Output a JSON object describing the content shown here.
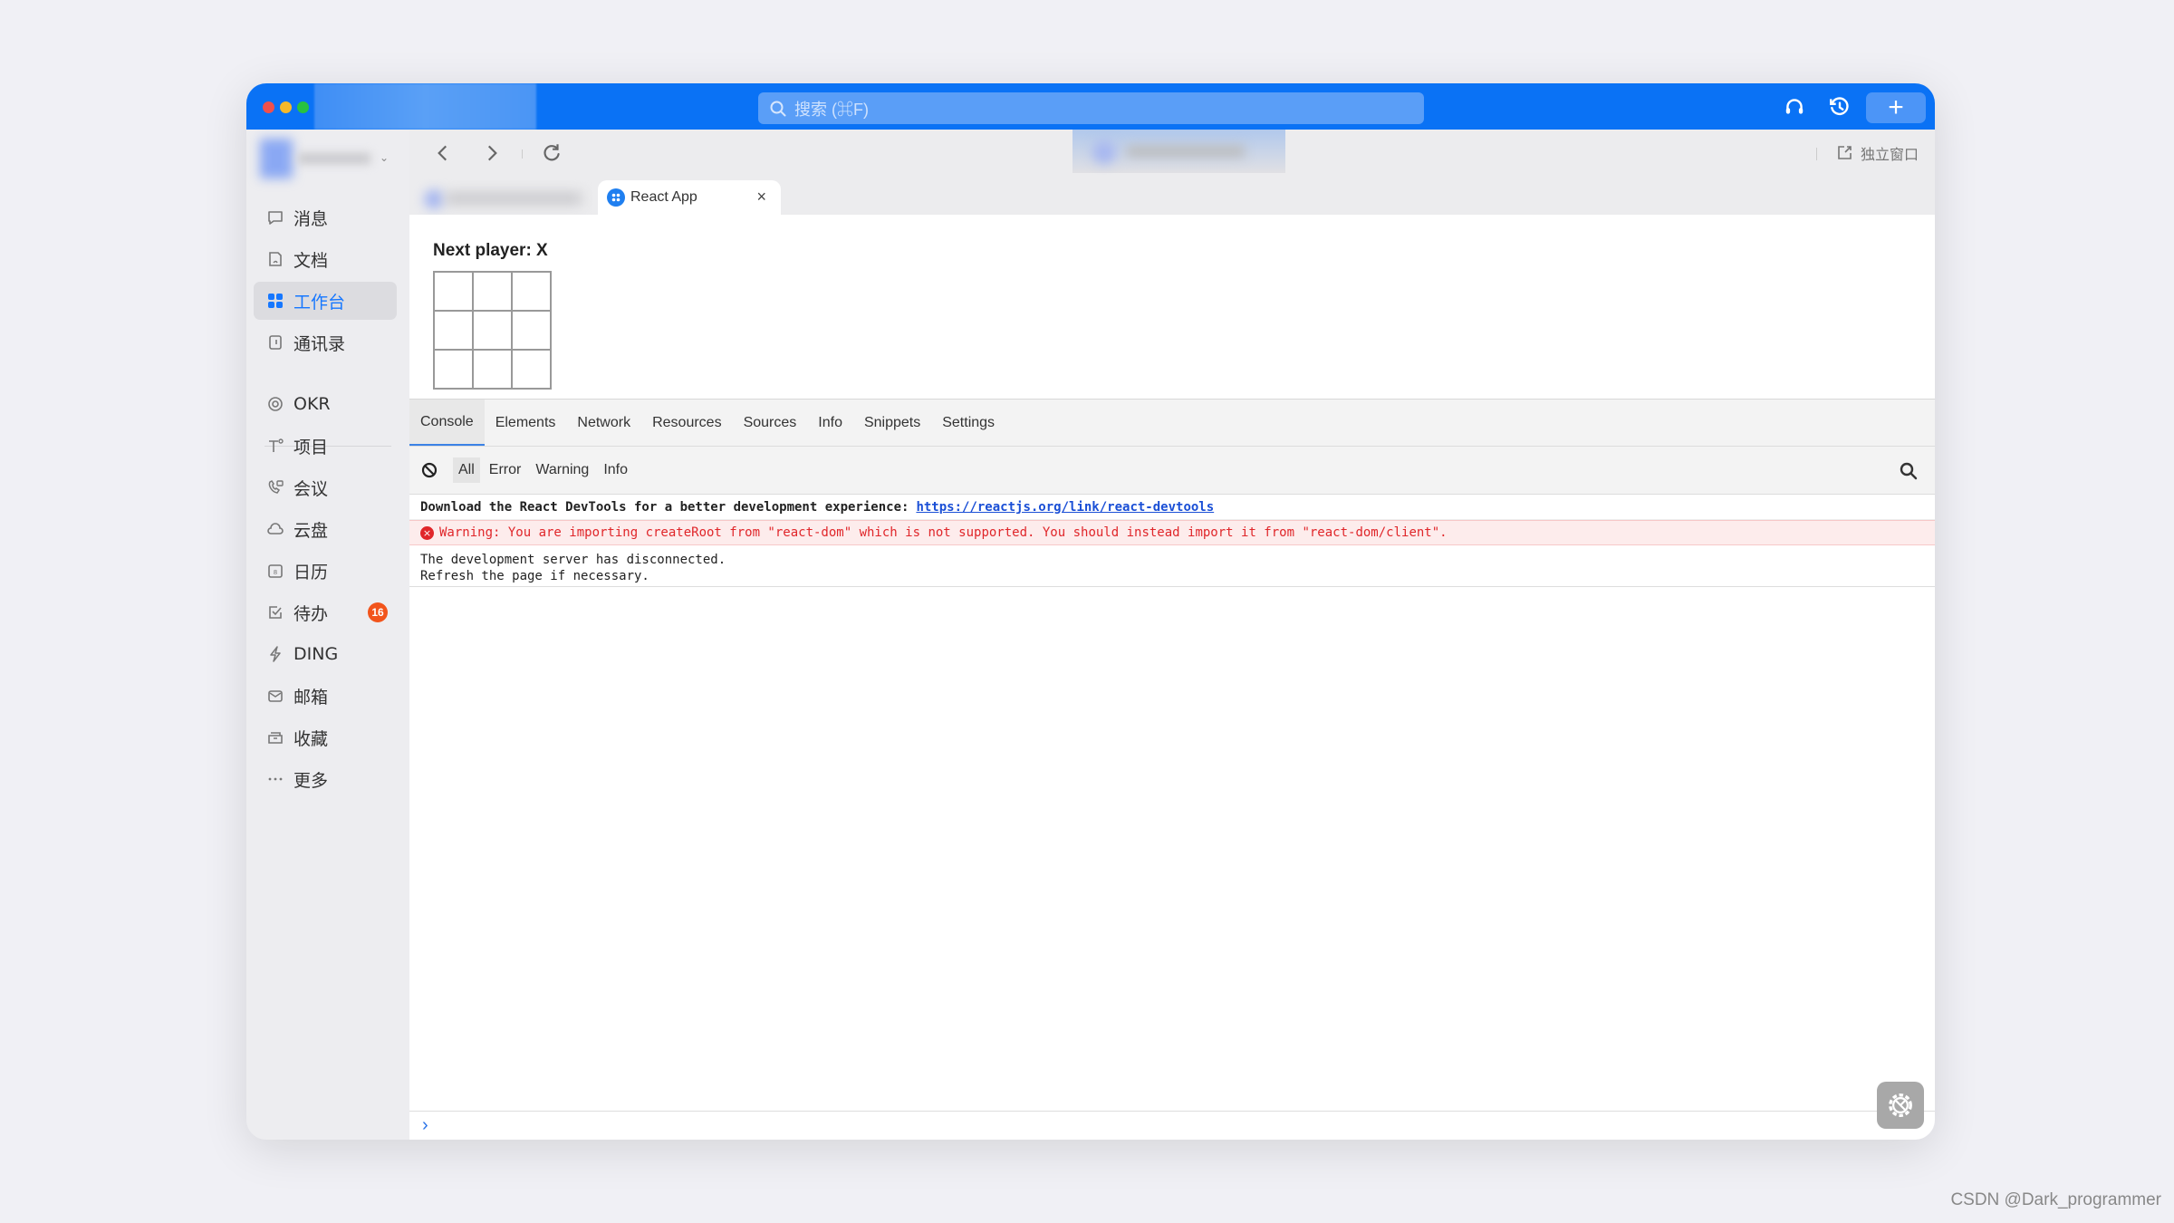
{
  "titlebar": {
    "search_placeholder": "搜索 (⌘F)",
    "plus_label": "+"
  },
  "sidebar": {
    "items": [
      {
        "label": "消息",
        "icon": "message-icon"
      },
      {
        "label": "文档",
        "icon": "document-icon"
      },
      {
        "label": "工作台",
        "icon": "workbench-icon",
        "active": true
      },
      {
        "label": "通讯录",
        "icon": "contacts-icon"
      },
      {
        "label": "OKR",
        "icon": "okr-icon"
      },
      {
        "label": "项目",
        "icon": "project-icon"
      },
      {
        "label": "会议",
        "icon": "meeting-icon"
      },
      {
        "label": "云盘",
        "icon": "cloud-drive-icon"
      },
      {
        "label": "日历",
        "icon": "calendar-icon"
      },
      {
        "label": "待办",
        "icon": "todo-icon",
        "badge": "16"
      },
      {
        "label": "DING",
        "icon": "ding-icon"
      },
      {
        "label": "邮箱",
        "icon": "mail-icon"
      },
      {
        "label": "收藏",
        "icon": "favorites-icon"
      },
      {
        "label": "更多",
        "icon": "more-icon"
      }
    ]
  },
  "browser": {
    "detach_label": "独立窗口",
    "active_tab": {
      "title": "React App",
      "close": "×"
    }
  },
  "page": {
    "status": "Next player: X",
    "squares": [
      "",
      "",
      "",
      "",
      "",
      "",
      "",
      "",
      ""
    ]
  },
  "devtools": {
    "tabs": [
      "Console",
      "Elements",
      "Network",
      "Resources",
      "Sources",
      "Info",
      "Snippets",
      "Settings"
    ],
    "active_tab": "Console",
    "filters": [
      "All",
      "Error",
      "Warning",
      "Info"
    ],
    "active_filter": "All",
    "logs": {
      "devtools_msg": "Download the React DevTools for a better development experience:",
      "devtools_link": "https://reactjs.org/link/react-devtools",
      "warning": "Warning: You are importing createRoot from \"react-dom\" which is not supported. You should instead import it from \"react-dom/client\".",
      "disconnect_line1": "The development server has disconnected.",
      "disconnect_line2": "Refresh the page if necessary."
    },
    "prompt_symbol": "›"
  },
  "watermark": "CSDN @Dark_programmer",
  "colors": {
    "titlebar_blue": "#0a72f5",
    "active_nav": "#1677ff",
    "badge": "#f2541b",
    "error_red": "#e0262a",
    "link_blue": "#1a4fd6"
  }
}
